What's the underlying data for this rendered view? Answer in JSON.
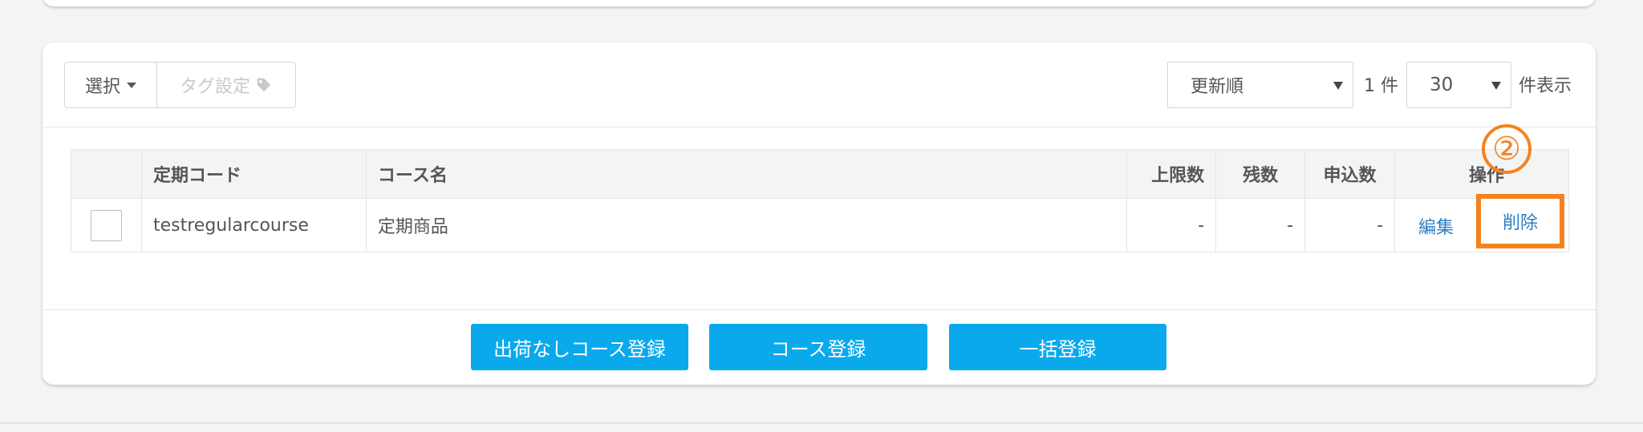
{
  "toolbar": {
    "select_label": "選択",
    "tag_label": "タグ設定",
    "sort_value": "更新順",
    "count_text": "1 件",
    "per_page_value": "30",
    "display_suffix": "件表示"
  },
  "table": {
    "headers": {
      "code": "定期コード",
      "name": "コース名",
      "limit": "上限数",
      "remaining": "残数",
      "applied": "申込数",
      "ops": "操作"
    },
    "rows": [
      {
        "code": "testregularcourse",
        "name": "定期商品",
        "limit": "-",
        "remaining": "-",
        "applied": "-",
        "edit": "編集",
        "delete": "削除"
      }
    ]
  },
  "annotation": {
    "marker": "②",
    "color": "#f5821f"
  },
  "actions": {
    "no_shipping_course": "出荷なしコース登録",
    "course_register": "コース登録",
    "bulk_register": "一括登録"
  },
  "colors": {
    "accent": "#09a9ec",
    "link": "#2d7fc1",
    "highlight": "#f5821f"
  }
}
